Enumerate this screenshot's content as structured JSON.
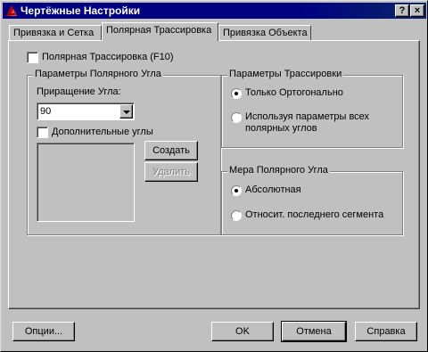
{
  "window": {
    "title": "Чертёжные Настройки",
    "help_button": "?",
    "close_button": "×"
  },
  "tabs": [
    {
      "label": "Привязка и Сетка",
      "active": false
    },
    {
      "label": "Полярная Трассировка",
      "active": true
    },
    {
      "label": "Привязка Объекта",
      "active": false
    }
  ],
  "polar": {
    "toggle_label": "Полярная Трассировка (F10)",
    "toggle_checked": false,
    "angle_group": {
      "title": "Параметры Полярного Угла",
      "increment_label": "Приращение Угла:",
      "increment_value": "90",
      "additional_label": "Дополнительные углы",
      "additional_checked": false,
      "create_button": "Создать",
      "delete_button": "Удалить"
    },
    "tracking_group": {
      "title": "Параметры Трассировки",
      "option_ortho": "Только Ортогонально",
      "option_all_line1": "Используя параметры всех",
      "option_all_line2": "полярных углов",
      "selected": "ortho"
    },
    "measure_group": {
      "title": "Мера Полярного Угла",
      "option_absolute": "Абсолютная",
      "option_relative": "Относит. последнего сегмента",
      "selected": "absolute"
    }
  },
  "footer": {
    "options_button": "Опции...",
    "ok_button": "OK",
    "cancel_button": "Отмена",
    "help_button": "Справка"
  }
}
